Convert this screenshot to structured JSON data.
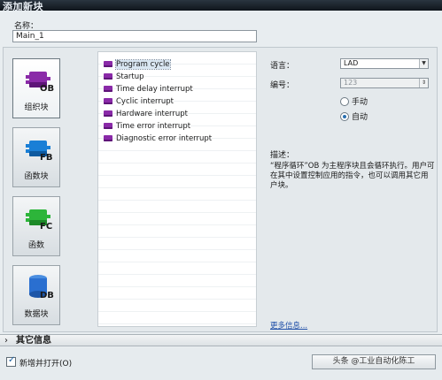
{
  "window": {
    "title": "添加新块"
  },
  "name_field": {
    "label": "名称：",
    "value": "Main_1"
  },
  "block_types": [
    {
      "label": "组织块",
      "code": "OB",
      "color": "#8a2aa8",
      "selected": true
    },
    {
      "label": "函数块",
      "code": "FB",
      "color": "#1a7fd6",
      "selected": false
    },
    {
      "label": "函数",
      "code": "FC",
      "color": "#2db53a",
      "selected": false
    },
    {
      "label": "数据块",
      "code": "DB",
      "color": "#2a6fd0",
      "selected": false
    }
  ],
  "ob_list": [
    "Program cycle",
    "Startup",
    "Time delay interrupt",
    "Cyclic interrupt",
    "Hardware interrupt",
    "Time error interrupt",
    "Diagnostic error interrupt"
  ],
  "properties": {
    "language_label": "语言：",
    "language_value": "LAD",
    "number_label": "编号：",
    "number_value": "123",
    "manual_label": "手动",
    "auto_label": "自动",
    "description_label": "描述：",
    "description_text": "“程序循环”OB 为主程序块且会循环执行。用户可在其中设置控制应用的指令，也可以调用其它用户块。",
    "more_info": "更多信息..."
  },
  "section": {
    "other_info": "其它信息"
  },
  "footer": {
    "open_checkbox_label": "新增并打开(O)",
    "ok_button": "头条 @工业自动化陈工"
  }
}
